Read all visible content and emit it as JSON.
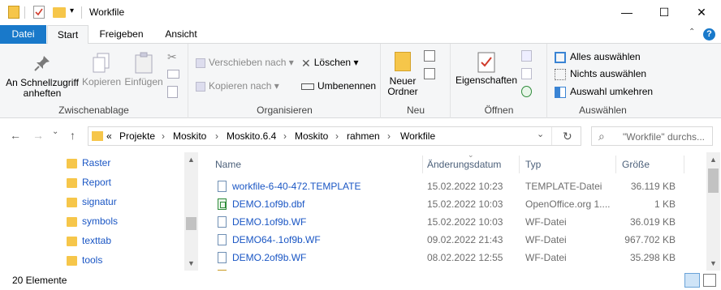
{
  "window": {
    "title": "Workfile",
    "minimize_glyph": "—",
    "maximize_glyph": "☐",
    "close_glyph": "✕",
    "qat_dropdown_glyph": "▾"
  },
  "tabs": [
    {
      "label": "Datei"
    },
    {
      "label": "Start"
    },
    {
      "label": "Freigeben"
    },
    {
      "label": "Ansicht"
    }
  ],
  "ribbon": {
    "clipboard": {
      "label": "Zwischenablage",
      "pin": "An Schnellzugriff anheften",
      "copy": "Kopieren",
      "paste": "Einfügen"
    },
    "organize": {
      "label": "Organisieren",
      "move_to": "Verschieben nach",
      "copy_to": "Kopieren nach",
      "delete": "Löschen",
      "rename": "Umbenennen"
    },
    "new": {
      "label": "Neu",
      "new_folder_line1": "Neuer",
      "new_folder_line2": "Ordner"
    },
    "open": {
      "label": "Öffnen",
      "properties": "Eigenschaften"
    },
    "select": {
      "label": "Auswählen",
      "select_all": "Alles auswählen",
      "select_none": "Nichts auswählen",
      "invert": "Auswahl umkehren"
    }
  },
  "nav": {
    "back": "←",
    "forward": "→",
    "recent": "⌄",
    "up": "↑",
    "overflow": "«",
    "breadcrumbs": [
      "Projekte",
      "Moskito",
      "Moskito.6.4",
      "Moskito",
      "rahmen",
      "Workfile"
    ],
    "separator": "›",
    "dropdown": "⌄",
    "refresh": "↻",
    "search_placeholder": "\"Workfile\" durchs...",
    "search_icon": "⌕"
  },
  "tree": [
    {
      "label": "Raster"
    },
    {
      "label": "Report"
    },
    {
      "label": "signatur"
    },
    {
      "label": "symbols"
    },
    {
      "label": "texttab"
    },
    {
      "label": "tools"
    }
  ],
  "columns": {
    "name": "Name",
    "date": "Änderungsdatum",
    "type": "Typ",
    "size": "Größe"
  },
  "files": [
    {
      "name": "workfile-6-40-472.TEMPLATE",
      "date": "15.02.2022 10:23",
      "type": "TEMPLATE-Datei",
      "size": "36.119 KB",
      "icon": "doc-icon"
    },
    {
      "name": "DEMO.1of9b.dbf",
      "date": "15.02.2022 10:03",
      "type": "OpenOffice.org 1....",
      "size": "1 KB",
      "icon": "calc-icon"
    },
    {
      "name": "DEMO.1of9b.WF",
      "date": "15.02.2022 10:03",
      "type": "WF-Datei",
      "size": "36.019 KB",
      "icon": "doc-icon"
    },
    {
      "name": "DEMO64-.1of9b.WF",
      "date": "09.02.2022 21:43",
      "type": "WF-Datei",
      "size": "967.702 KB",
      "icon": "doc-icon"
    },
    {
      "name": "DEMO.2of9b.WF",
      "date": "08.02.2022 12:55",
      "type": "WF-Datei",
      "size": "35.298 KB",
      "icon": "doc-icon"
    }
  ],
  "status": {
    "count": "20 Elemente"
  }
}
